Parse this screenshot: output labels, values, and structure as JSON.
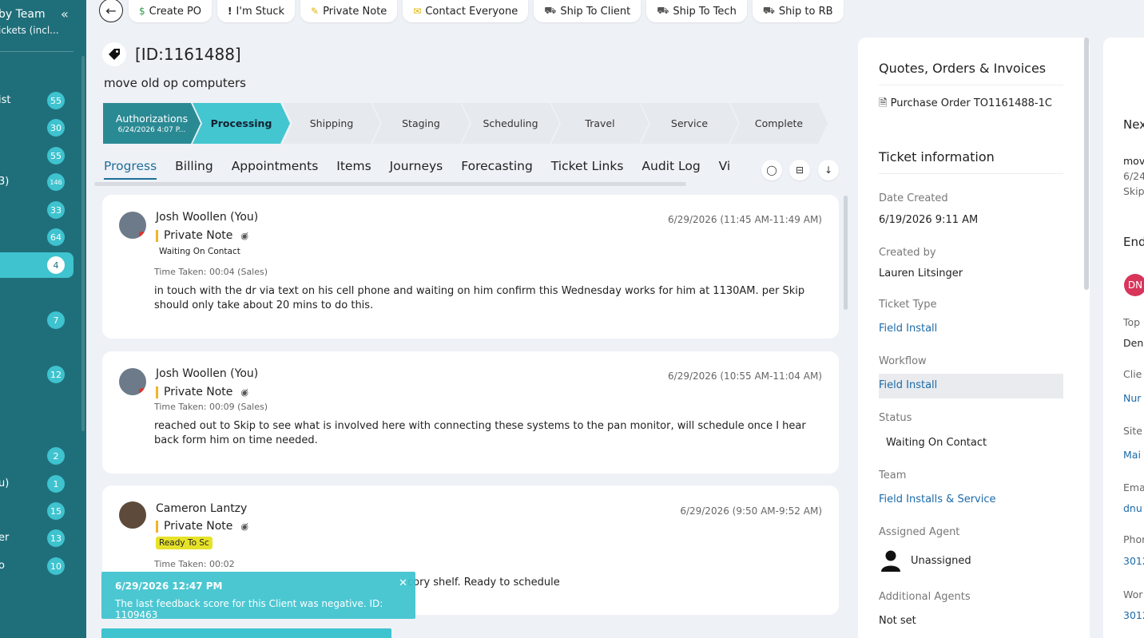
{
  "sidebar": {
    "title": "by Team",
    "subtitle": "ickets (incl...",
    "items": [
      {
        "label": "ist",
        "count": "55"
      },
      {
        "label": "",
        "count": "30"
      },
      {
        "label": "",
        "count": "55"
      },
      {
        "label": "3)",
        "count": "146"
      },
      {
        "label": "",
        "count": "33"
      },
      {
        "label": "",
        "count": "64"
      },
      {
        "label": "",
        "count": "4"
      },
      {
        "label": "",
        "count": "7"
      },
      {
        "label": "",
        "count": "12"
      },
      {
        "label": "",
        "count": "2"
      },
      {
        "label": "u)",
        "count": "1"
      },
      {
        "label": "",
        "count": "15"
      },
      {
        "label": "er",
        "count": "13"
      },
      {
        "label": "o",
        "count": "10"
      }
    ]
  },
  "toolbar": {
    "buttons": [
      {
        "label": "Create PO",
        "icon": "$"
      },
      {
        "label": "I'm Stuck",
        "icon": "!"
      },
      {
        "label": "Private Note",
        "icon": "note"
      },
      {
        "label": "Contact Everyone",
        "icon": "envelope"
      },
      {
        "label": "Ship To Client",
        "icon": "truck"
      },
      {
        "label": "Ship To Tech",
        "icon": "truck"
      },
      {
        "label": "Ship to RB",
        "icon": "truck"
      }
    ]
  },
  "ticket": {
    "id": "[ID:1161488]",
    "title": "move old op computers"
  },
  "stages": [
    {
      "label": "Authorizations",
      "sub": "6/24/2026 4:07 P..."
    },
    {
      "label": "Processing",
      "sub": ""
    },
    {
      "label": "Shipping",
      "sub": ""
    },
    {
      "label": "Staging",
      "sub": ""
    },
    {
      "label": "Scheduling",
      "sub": ""
    },
    {
      "label": "Travel",
      "sub": ""
    },
    {
      "label": "Service",
      "sub": ""
    },
    {
      "label": "Complete",
      "sub": ""
    }
  ],
  "tabs": [
    "Progress",
    "Billing",
    "Appointments",
    "Items",
    "Journeys",
    "Forecasting",
    "Ticket Links",
    "Audit Log",
    "Vi"
  ],
  "notes": [
    {
      "author": "Josh Woollen (You)",
      "timestamp": "6/29/2026 (11:45 AM-11:49 AM)",
      "type": "Private Note",
      "status": "Waiting On Contact",
      "time_taken": "Time Taken: 00:04 (Sales)",
      "body": "in touch with the dr via text on his cell phone and waiting on him confirm this Wednesday works for him at 1130AM.  per Skip should only take about 20 mins to do this."
    },
    {
      "author": "Josh Woollen (You)",
      "timestamp": "6/29/2026 (10:55 AM-11:04 AM)",
      "type": "Private Note",
      "status": "",
      "time_taken": "Time Taken: 00:09 (Sales)",
      "body": "reached out to Skip to see what is involved here with connecting these systems to the pan monitor, will schedule once I hear back form him on time needed."
    },
    {
      "author": "Cameron Lantzy",
      "timestamp": "6/29/2026 (9:50 AM-9:52 AM)",
      "type": "Private Note",
      "status": "Ready To Sc",
      "time_taken": "Time Taken: 00:02",
      "body": "cory shelf. Ready to schedule"
    }
  ],
  "toast": {
    "date": "6/29/2026 12:47 PM",
    "message": "The last feedback score for this Client was negative. ID: 1109463"
  },
  "right_panel": {
    "quotes_title": "Quotes, Orders & Invoices",
    "purchase_order": "Purchase Order TO1161488-1C",
    "info_title": "Ticket information",
    "fields": {
      "date_created_label": "Date Created",
      "date_created": "6/19/2026 9:11 AM",
      "created_by_label": "Created by",
      "created_by": "Lauren Litsinger",
      "ticket_type_label": "Ticket Type",
      "ticket_type": "Field Install",
      "workflow_label": "Workflow",
      "workflow": "Field Install",
      "status_label": "Status",
      "status": "Waiting On Contact",
      "team_label": "Team",
      "team": "Field Installs & Service",
      "agent_label": "Assigned Agent",
      "agent": "Unassigned",
      "additional_label": "Additional Agents",
      "additional": "Not set"
    }
  },
  "far_panel": {
    "next_title": "Nex",
    "next_line1": "mov",
    "next_line2": "6/24",
    "next_line3": "Skip",
    "end_title": "End",
    "avatar": "DN",
    "top_label": "Top",
    "top_value": "Den",
    "client_label": "Clie",
    "client_value": "Nur",
    "site_label": "Site",
    "site_value": "Mai",
    "email_label": "Ema",
    "email_value": "dnu",
    "phone_label": "Phon",
    "phone_value": "3012",
    "work_label": "Wor",
    "work_value": "3012"
  },
  "colors": {
    "sidebar_bg": "#1f6f7a",
    "accent": "#3ec3cf",
    "link": "#1c6aa8",
    "note_marker": "#f0b429",
    "status_yellow": "#e6e22a"
  }
}
